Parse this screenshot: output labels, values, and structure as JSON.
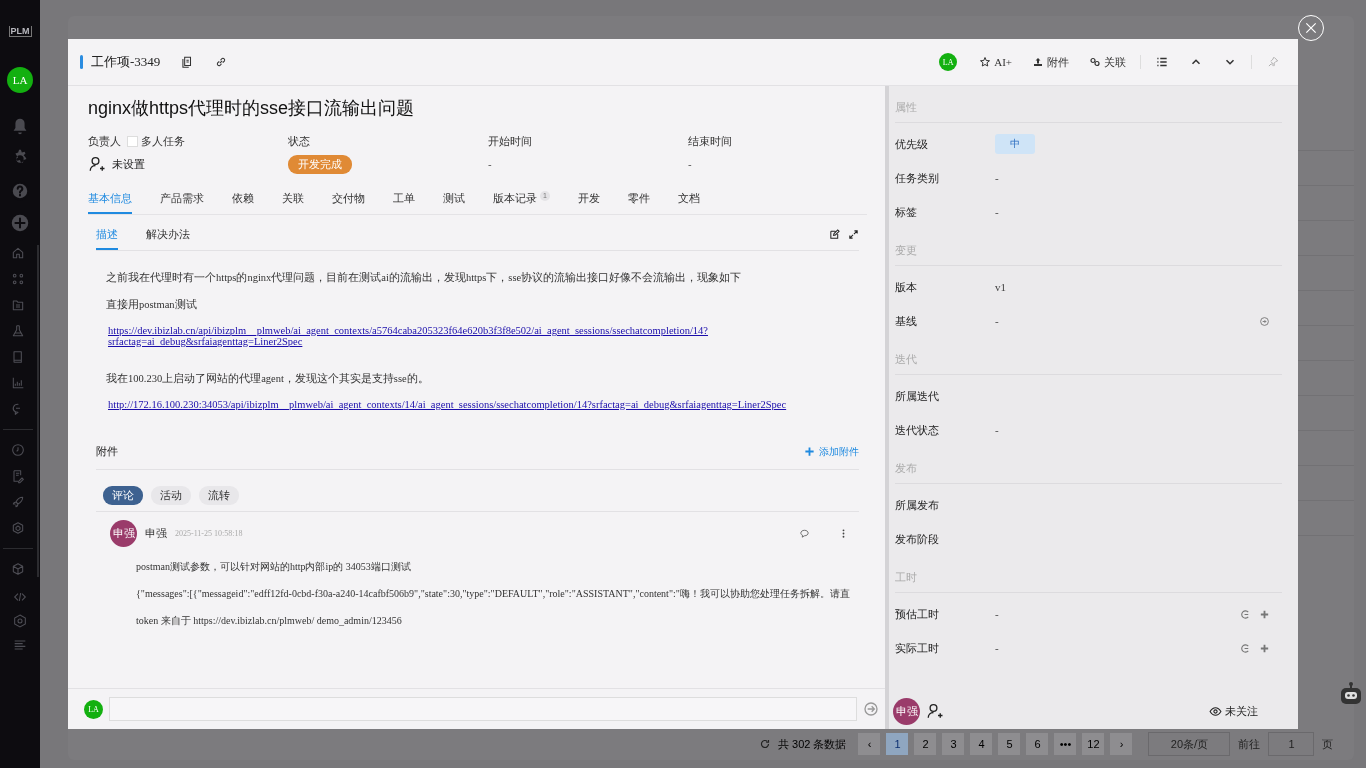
{
  "app_sidebar": {
    "logo": "PLM",
    "avatar": "LA"
  },
  "pagination": {
    "total": "共 302 条数据",
    "prev": "‹",
    "next": "›",
    "pages": [
      {
        "label": "1",
        "selected": true
      },
      {
        "label": "2",
        "selected": false
      },
      {
        "label": "3",
        "selected": false
      },
      {
        "label": "4",
        "selected": false
      },
      {
        "label": "5",
        "selected": false
      },
      {
        "label": "6",
        "selected": false
      },
      {
        "label": "•••",
        "selected": false
      },
      {
        "label": "12",
        "selected": false
      }
    ],
    "page_size": "20条/页",
    "goto_label": "前往",
    "goto_value": "1",
    "page_suffix": "页"
  },
  "modal": {
    "item_id": "工作项-3349",
    "toolbar": {
      "avatar": "LA",
      "buttons": [
        {
          "kind": "ai",
          "label": "AI+"
        },
        {
          "kind": "upload",
          "label": "附件"
        },
        {
          "kind": "link",
          "label": "关联"
        }
      ]
    },
    "title": "nginx做https代理时的sse接口流输出问题",
    "assignee": {
      "label": "负责人",
      "multi_label": "多人任务",
      "multi_checked": false,
      "value": "未设置"
    },
    "status": {
      "label": "状态",
      "value": "开发完成"
    },
    "start": {
      "label": "开始时间",
      "value": "-"
    },
    "end": {
      "label": "结束时间",
      "value": "-"
    },
    "tabs": [
      {
        "label": "基本信息",
        "selected": true
      },
      {
        "label": "产品需求",
        "selected": false
      },
      {
        "label": "依赖",
        "selected": false
      },
      {
        "label": "关联",
        "selected": false
      },
      {
        "label": "交付物",
        "selected": false
      },
      {
        "label": "工单",
        "selected": false
      },
      {
        "label": "测试",
        "selected": false
      },
      {
        "label": "版本记录",
        "selected": false,
        "badge": "1"
      },
      {
        "label": "开发",
        "selected": false
      },
      {
        "label": "零件",
        "selected": false
      },
      {
        "label": "文档",
        "selected": false
      }
    ],
    "subtabs": [
      {
        "label": "描述",
        "selected": true
      },
      {
        "label": "解决办法",
        "selected": false
      }
    ],
    "description": [
      {
        "kind": "text",
        "text": "之前我在代理时有一个https的nginx代理问题，目前在测试ai的流输出，发现https下，sse协议的流输出接口好像不会流输出，现象如下"
      },
      {
        "kind": "text",
        "text": "直接用postman测试"
      },
      {
        "kind": "link",
        "text": "https://dev.ibizlab.cn/api/ibizplm__plmweb/ai_agent_contexts/a5764caba205323f64e620b3f3f8e502/ai_agent_sessions/ssechatcompletion/14?srfactag=ai_debug&srfaiagenttag=Liner2Spec"
      },
      {
        "kind": "gap"
      },
      {
        "kind": "text",
        "text": "我在100.230上启动了网站的代理agent，发现这个其实是支持sse的。"
      },
      {
        "kind": "link",
        "text": "http://172.16.100.230:34053/api/ibizplm__plmweb/ai_agent_contexts/14/ai_agent_sessions/ssechatcompletion/14?srfactag=ai_debug&srfaiagenttag=Liner2Spec"
      }
    ],
    "attachments": {
      "title": "附件",
      "add_label": "添加附件"
    },
    "activity_tabs": [
      {
        "label": "评论",
        "selected": true
      },
      {
        "label": "活动",
        "selected": false
      },
      {
        "label": "流转",
        "selected": false
      }
    ],
    "comments": [
      {
        "author": "申强",
        "avatar": "申强",
        "time": "2025-11-25 10:58:18",
        "lines": [
          "postman测试参数，可以针对网站的http内部ip的 34053端口测试",
          "{\"messages\":[{\"messageid\":\"edff12fd-0cbd-f30a-a240-14cafbf506b9\",\"state\":30,\"type\":\"DEFAULT\",\"role\":\"ASSISTANT\",\"content\":\"嗨！我可以协助您处理任务拆解。请直",
          "token   来自于  https://dev.ibizlab.cn/plmweb/   demo_admin/123456"
        ]
      }
    ],
    "comment_input": {
      "avatar": "LA"
    },
    "sections": [
      {
        "title": "属性",
        "fields": [
          {
            "label": "优先级",
            "kind": "tag",
            "value": "中"
          },
          {
            "label": "任务类别",
            "kind": "plain",
            "value": "-"
          },
          {
            "label": "标签",
            "kind": "plain",
            "value": "-"
          }
        ]
      },
      {
        "title": "变更",
        "fields": [
          {
            "label": "版本",
            "kind": "plain",
            "value": "v1"
          },
          {
            "label": "基线",
            "kind": "select",
            "value": "-"
          }
        ]
      },
      {
        "title": "迭代",
        "fields": [
          {
            "label": "所属迭代",
            "kind": "plain"
          },
          {
            "label": "迭代状态",
            "kind": "plain",
            "value": "-"
          }
        ]
      },
      {
        "title": "发布",
        "fields": [
          {
            "label": "所属发布",
            "kind": "plain"
          },
          {
            "label": "发布阶段",
            "kind": "plain"
          }
        ]
      },
      {
        "title": "工时",
        "fields": [
          {
            "label": "预估工时",
            "kind": "hours",
            "value": "-"
          },
          {
            "label": "实际工时",
            "kind": "hours",
            "value": "-"
          }
        ]
      }
    ],
    "footer": {
      "avatar": "申强",
      "follow_label": "未关注"
    }
  }
}
